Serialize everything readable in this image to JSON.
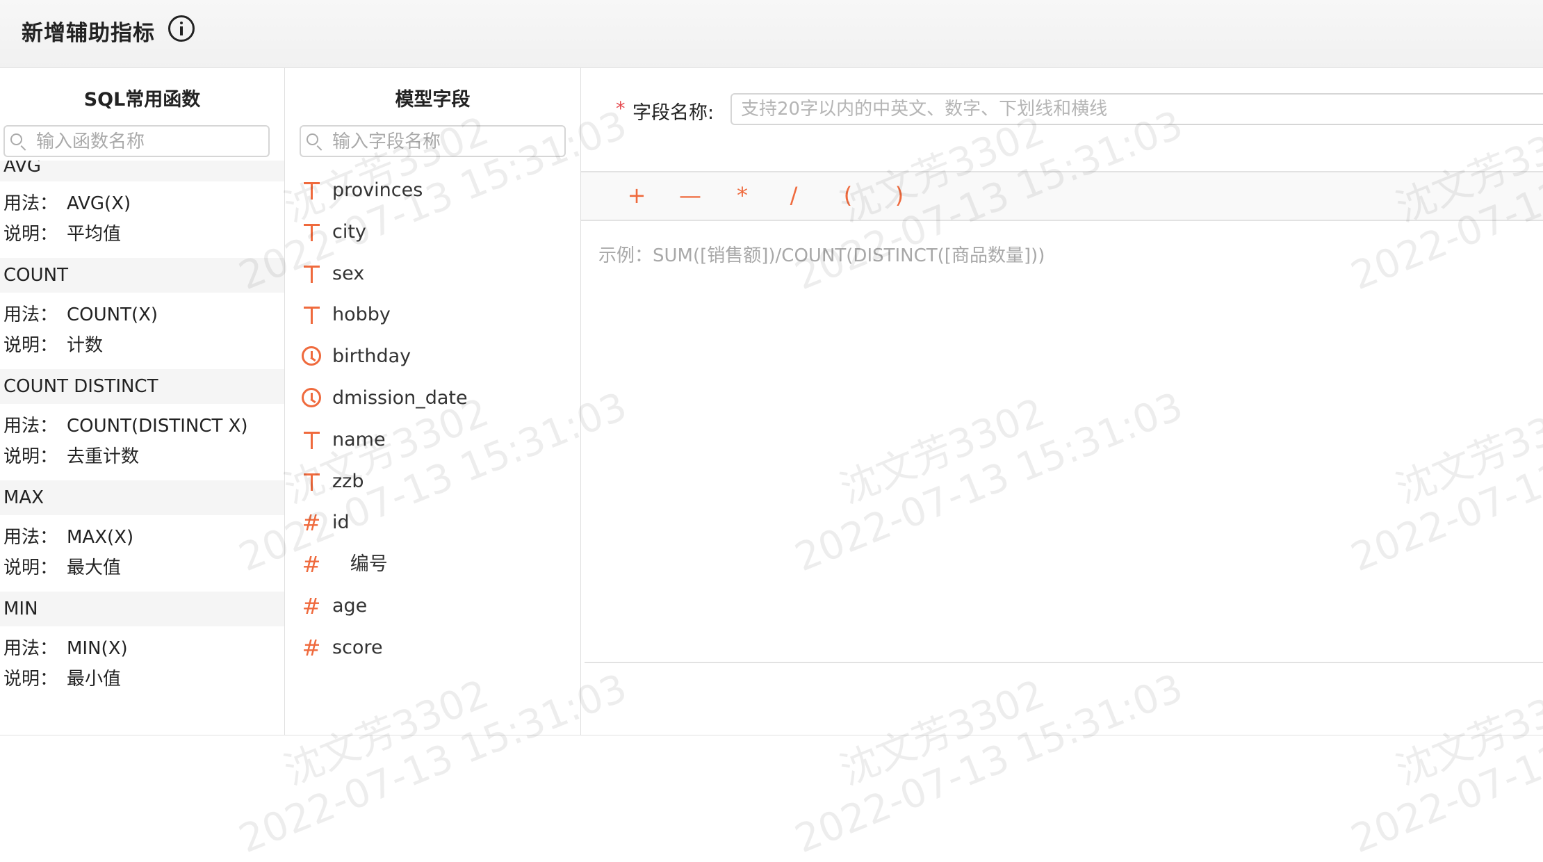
{
  "header": {
    "title": "新增辅助指标",
    "info_icon": "info-circle-icon"
  },
  "functions_panel": {
    "title": "SQL常用函数",
    "search_placeholder": "输入函数名称",
    "items": [
      {
        "name": "AVG",
        "usage_key": "用法：",
        "usage": "AVG(X)",
        "desc_key": "说明：",
        "desc": "平均值"
      },
      {
        "name": "COUNT",
        "usage_key": "用法：",
        "usage": "COUNT(X)",
        "desc_key": "说明：",
        "desc": "计数"
      },
      {
        "name": "COUNT DISTINCT",
        "usage_key": "用法：",
        "usage": "COUNT(DISTINCT X)",
        "desc_key": "说明：",
        "desc": "去重计数"
      },
      {
        "name": "MAX",
        "usage_key": "用法：",
        "usage": "MAX(X)",
        "desc_key": "说明：",
        "desc": "最大值"
      },
      {
        "name": "MIN",
        "usage_key": "用法：",
        "usage": "MIN(X)",
        "desc_key": "说明：",
        "desc": "最小值"
      }
    ]
  },
  "fields_panel": {
    "title": "模型字段",
    "search_placeholder": "输入字段名称",
    "accent_color": "#ef6a3d",
    "fields": [
      {
        "icon": "text-type-icon",
        "label": "provinces"
      },
      {
        "icon": "text-type-icon",
        "label": "city"
      },
      {
        "icon": "text-type-icon",
        "label": "sex"
      },
      {
        "icon": "text-type-icon",
        "label": "hobby"
      },
      {
        "icon": "clock-icon",
        "label": "birthday"
      },
      {
        "icon": "clock-icon",
        "label": "dmission_date"
      },
      {
        "icon": "text-type-icon",
        "label": "name"
      },
      {
        "icon": "text-type-icon",
        "label": "zzb"
      },
      {
        "icon": "hash-icon",
        "label": "id"
      },
      {
        "icon": "hash-icon",
        "label": "   编号"
      },
      {
        "icon": "hash-icon",
        "label": "age"
      },
      {
        "icon": "hash-icon",
        "label": "score"
      }
    ]
  },
  "editor": {
    "required_mark": "*",
    "field_name_label": "字段名称:",
    "field_name_placeholder": "支持20字以内的中英文、数字、下划线和横线",
    "operators": [
      "+",
      "—",
      "*",
      "/",
      "(",
      ")"
    ],
    "example": "示例：SUM([销售额])/COUNT(DISTINCT([商品数量]))"
  },
  "watermark": {
    "line1": "沈文芳3302",
    "line2": "2022-07-13 15:31:03"
  }
}
